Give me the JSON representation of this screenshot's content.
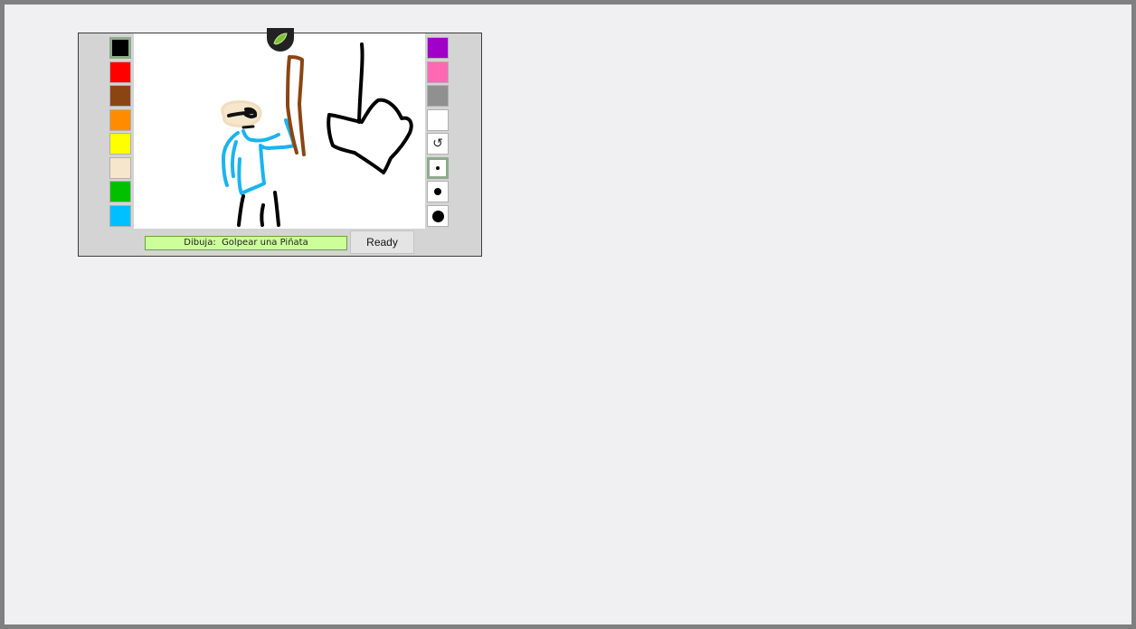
{
  "game": {
    "prompt_label": "Dibuja:  Golpear una Piñata",
    "ready_label": "Ready",
    "left_palette": [
      {
        "name": "black",
        "color": "#000000",
        "selected": true
      },
      {
        "name": "red",
        "color": "#ff0000",
        "selected": false
      },
      {
        "name": "brown",
        "color": "#8b4513",
        "selected": false
      },
      {
        "name": "orange",
        "color": "#ff8c00",
        "selected": false
      },
      {
        "name": "yellow",
        "color": "#ffff00",
        "selected": false
      },
      {
        "name": "beige",
        "color": "#f5e6cc",
        "selected": false
      },
      {
        "name": "green",
        "color": "#00c000",
        "selected": false
      },
      {
        "name": "sky-blue",
        "color": "#00bfff",
        "selected": false
      }
    ],
    "right_palette": [
      {
        "name": "purple",
        "color": "#a000c8",
        "selected": false
      },
      {
        "name": "pink",
        "color": "#ff69b4",
        "selected": false
      },
      {
        "name": "gray",
        "color": "#909090",
        "selected": false
      },
      {
        "name": "white",
        "color": "#ffffff",
        "selected": false
      }
    ],
    "tools": [
      {
        "name": "undo-icon",
        "glyph": "↺"
      },
      {
        "name": "brush-small-icon",
        "selected": true
      },
      {
        "name": "brush-medium-icon",
        "selected": false
      },
      {
        "name": "brush-large-icon",
        "selected": false
      }
    ]
  }
}
